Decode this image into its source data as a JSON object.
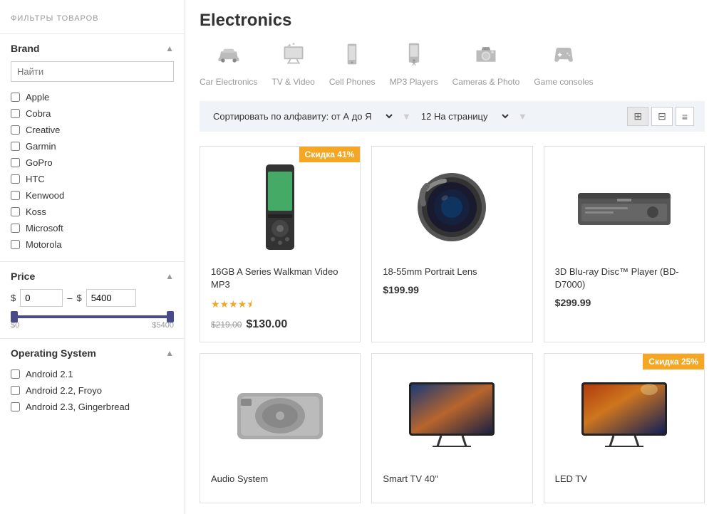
{
  "sidebar": {
    "title": "ФИЛЬТРЫ ТОВАРОВ",
    "brand_section": {
      "label": "Brand",
      "search_placeholder": "Найти",
      "brands": [
        {
          "name": "Apple",
          "checked": false
        },
        {
          "name": "Cobra",
          "checked": false
        },
        {
          "name": "Creative",
          "checked": false
        },
        {
          "name": "Garmin",
          "checked": false
        },
        {
          "name": "GoPro",
          "checked": false
        },
        {
          "name": "HTC",
          "checked": false
        },
        {
          "name": "Kenwood",
          "checked": false
        },
        {
          "name": "Koss",
          "checked": false
        },
        {
          "name": "Microsoft",
          "checked": false
        },
        {
          "name": "Motorola",
          "checked": false
        }
      ]
    },
    "price_section": {
      "label": "Price",
      "min": "0",
      "max": "5400",
      "min_label": "$0",
      "max_label": "$5400"
    },
    "os_section": {
      "label": "Operating System",
      "items": [
        {
          "name": "Android 2.1",
          "checked": false
        },
        {
          "name": "Android 2.2, Froyo",
          "checked": false
        },
        {
          "name": "Android 2.3, Gingerbread",
          "checked": false
        }
      ]
    }
  },
  "main": {
    "title": "Electronics",
    "categories": [
      {
        "label": "Car Electronics",
        "icon": "car"
      },
      {
        "label": "TV & Video",
        "icon": "tv"
      },
      {
        "label": "Cell Phones",
        "icon": "phone"
      },
      {
        "label": "MP3 Players",
        "icon": "mp3"
      },
      {
        "label": "Cameras & Photo",
        "icon": "camera"
      },
      {
        "label": "Game consoles",
        "icon": "game"
      }
    ],
    "sort": {
      "sort_label": "Сортировать по алфавиту: от А до Я",
      "per_page_label": "12 На страницу"
    },
    "products": [
      {
        "name": "16GB A Series Walkman Video MP3",
        "price": "$130.00",
        "old_price": "$219.00",
        "rating": 4.5,
        "badge": "Скидка 41%",
        "has_badge": true,
        "img_type": "mp3_player"
      },
      {
        "name": "18-55mm Portrait Lens",
        "price": "$199.99",
        "old_price": "",
        "rating": 0,
        "badge": "",
        "has_badge": false,
        "img_type": "lens"
      },
      {
        "name": "3D Blu-ray Disc™ Player (BD-D7000)",
        "price": "$299.99",
        "old_price": "",
        "rating": 0,
        "badge": "",
        "has_badge": false,
        "img_type": "bluray"
      },
      {
        "name": "Audio System",
        "price": "",
        "old_price": "",
        "rating": 0,
        "badge": "",
        "has_badge": false,
        "img_type": "audio"
      },
      {
        "name": "Smart TV 40\"",
        "price": "",
        "old_price": "",
        "rating": 0,
        "badge": "",
        "has_badge": false,
        "img_type": "tv"
      },
      {
        "name": "LED TV",
        "price": "",
        "old_price": "",
        "rating": 0,
        "badge": "Скидка 25%",
        "has_badge": true,
        "img_type": "ledtv"
      }
    ]
  }
}
